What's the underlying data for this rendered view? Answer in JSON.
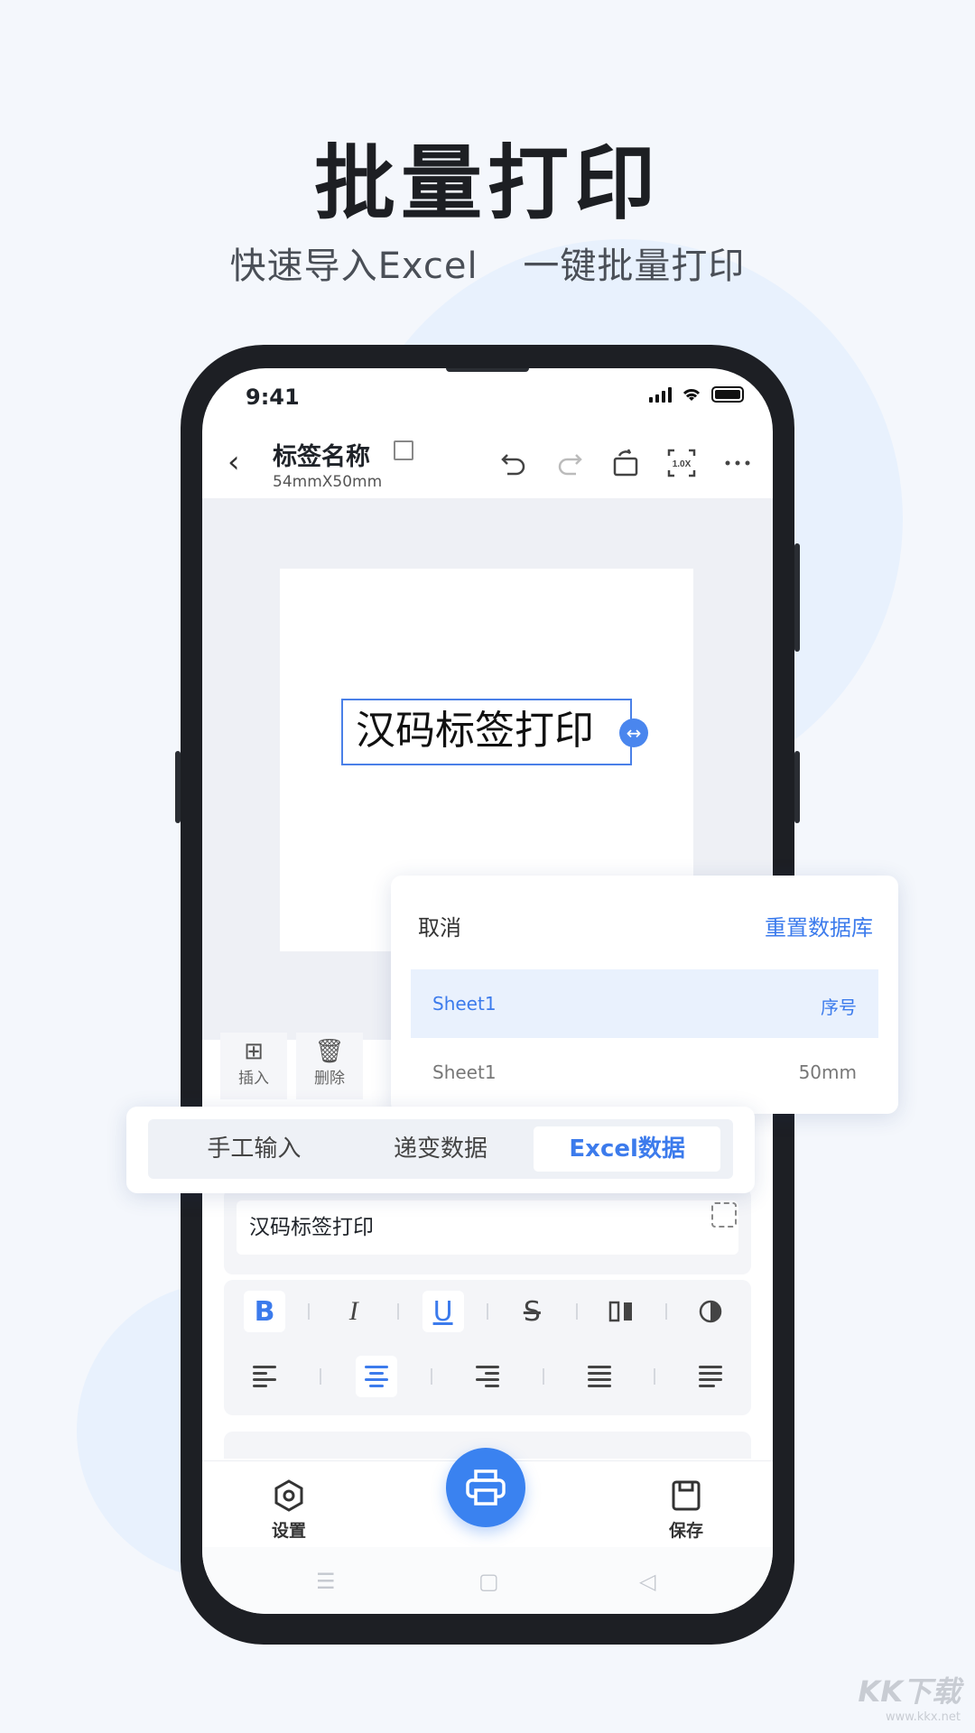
{
  "hero": {
    "title": "批量打印",
    "subtitle_part1": "快速导入Excel",
    "subtitle_part2": "一键批量打印"
  },
  "status_bar": {
    "time": "9:41"
  },
  "editor_header": {
    "label_name": "标签名称",
    "label_size": "54mmX50mm",
    "zoom": "1.0X"
  },
  "canvas": {
    "label_text": "汉码标签打印"
  },
  "mini_toolbar": {
    "insert": "插入",
    "delete": "删除"
  },
  "database_panel": {
    "cancel": "取消",
    "reset": "重置数据库",
    "rows": [
      {
        "sheet": "Sheet1",
        "field": "序号",
        "selected": true
      },
      {
        "sheet": "Sheet1",
        "field": "50mm",
        "selected": false
      }
    ]
  },
  "source_tabs": {
    "manual": "手工输入",
    "incremental": "递变数据",
    "excel": "Excel数据",
    "active": "Excel数据"
  },
  "content_field": {
    "value": "汉码标签打印"
  },
  "format_toolbar": {
    "bold": "B",
    "italic": "I",
    "underline": "U",
    "strike": "S"
  },
  "bottom_bar": {
    "settings": "设置",
    "save": "保存"
  },
  "colors": {
    "accent": "#3c7bec",
    "print_button": "#3a82f0",
    "background": "#f4f7fc"
  },
  "watermark": {
    "brand": "KK下载",
    "url": "www.kkx.net"
  }
}
